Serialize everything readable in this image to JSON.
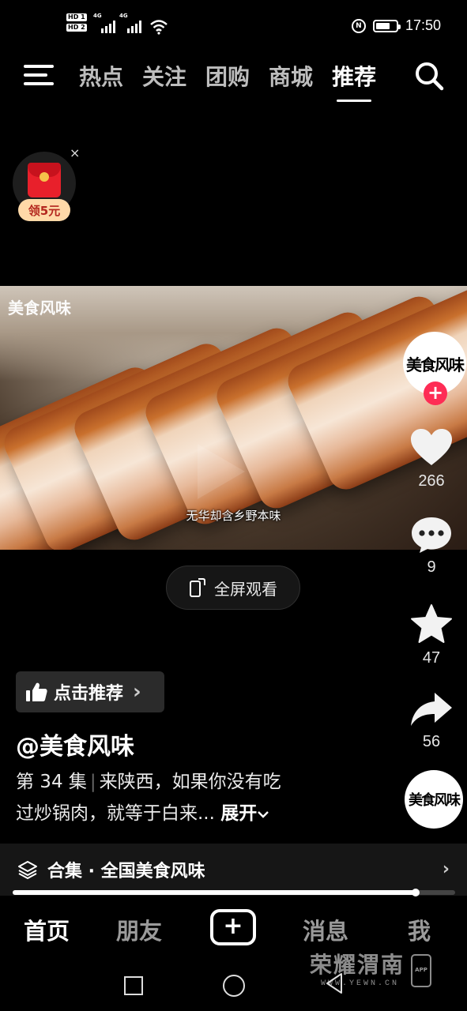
{
  "status_bar": {
    "sim1": "HD 1",
    "sim2": "HD 2",
    "net1": "4G",
    "net2": "4G",
    "time": "17:50"
  },
  "top_nav": {
    "tabs": [
      "热点",
      "关注",
      "团购",
      "商城",
      "推荐"
    ],
    "active_tab": "推荐"
  },
  "red_packet": {
    "badge": "领5元",
    "close": "×"
  },
  "video": {
    "logo": "美食风味",
    "subtitle": "无华却含乡野本味"
  },
  "fullscreen": {
    "label": "全屏观看"
  },
  "rail": {
    "avatar_text": "美食风味",
    "follow": "+",
    "likes": "266",
    "comments": "9",
    "favorites": "47",
    "shares": "56",
    "music_avatar_text": "美食风味"
  },
  "recommend": {
    "label": "点击推荐",
    "chevron": "›"
  },
  "author": "@美食风味",
  "description": {
    "episode": "第 34 集",
    "text_line1": "来陕西，如果你没有吃",
    "text_line2": "过炒锅肉，就等于白来...",
    "more": "展开"
  },
  "collection": {
    "label": "合集 · 全国美食风味",
    "chevron": "›"
  },
  "progress": {
    "value": 0.91
  },
  "bottom_nav": {
    "home": "首页",
    "friends": "朋友",
    "create": "+",
    "messages": "消息",
    "me": "我",
    "active": "首页"
  },
  "watermark": {
    "title": "荣耀渭南",
    "url": "WWW.YEWN.CN",
    "app": "APP"
  },
  "colors": {
    "accent": "#fe2c55",
    "background": "#000000",
    "red_packet": "#e8202b"
  }
}
